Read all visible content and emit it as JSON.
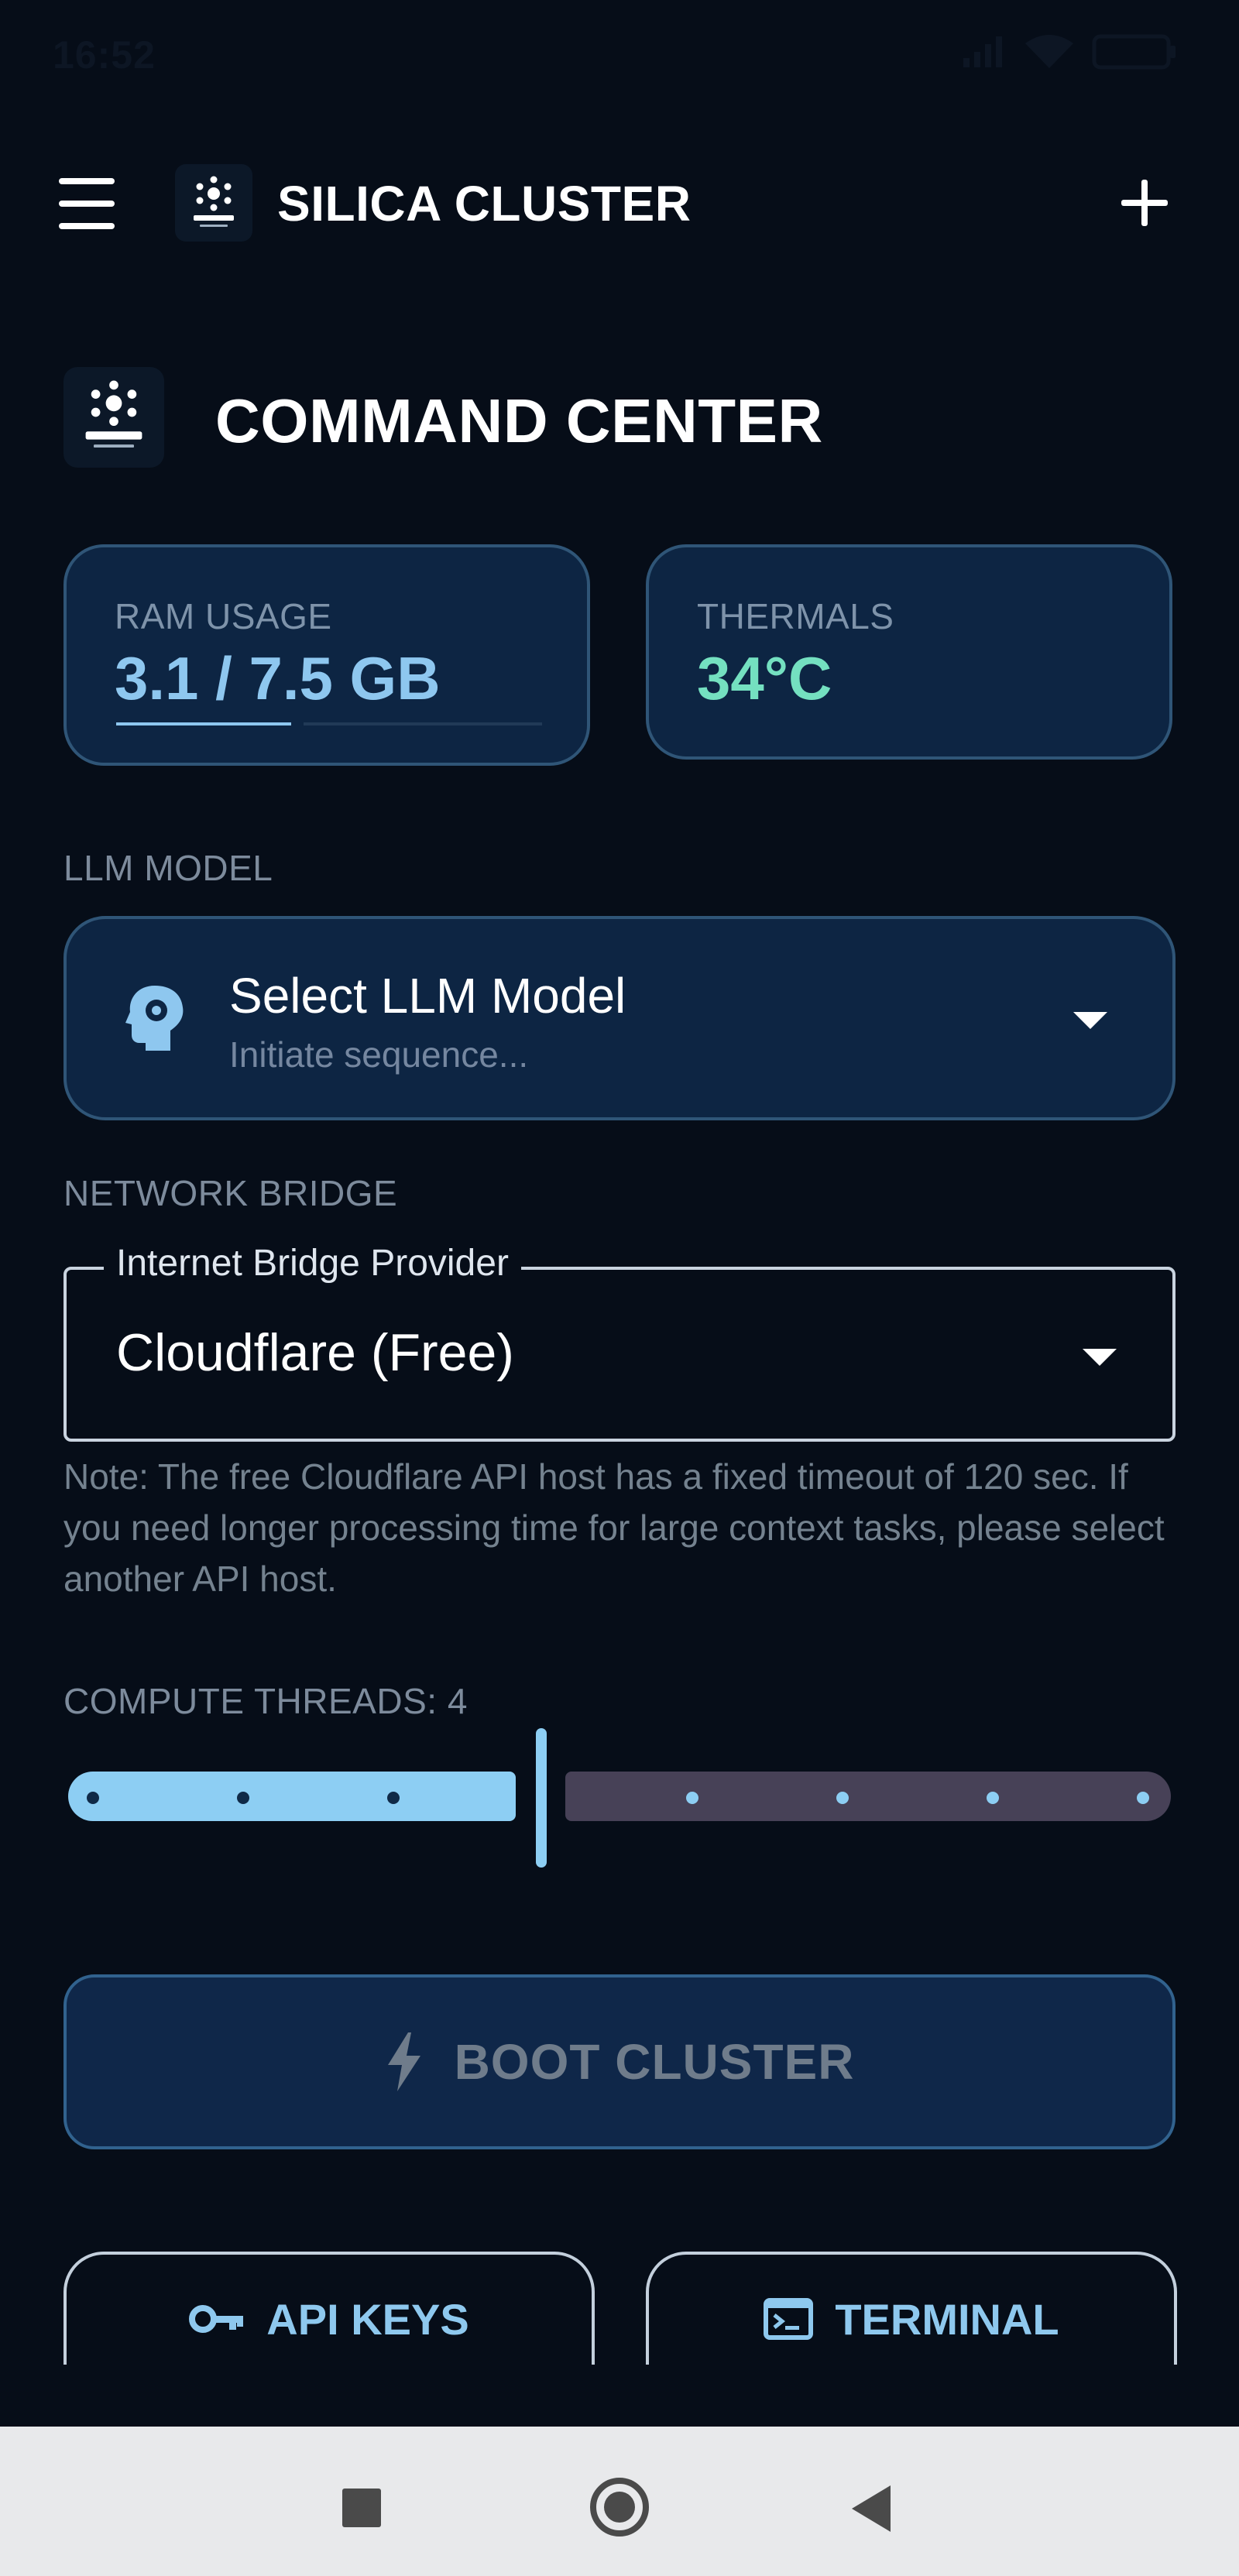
{
  "status_bar": {
    "time": "16:52"
  },
  "app_bar": {
    "title": "SILICA CLUSTER"
  },
  "section": {
    "title": "COMMAND CENTER"
  },
  "stats": {
    "ram": {
      "label": "RAM USAGE",
      "value": "3.1 / 7.5 GB",
      "fraction": 0.41,
      "color": "#8ec7ef"
    },
    "thermals": {
      "label": "THERMALS",
      "value": "34°C",
      "color": "#74e0c0"
    }
  },
  "llm": {
    "section_label": "LLM MODEL",
    "title": "Select LLM Model",
    "subtitle": "Initiate sequence..."
  },
  "network": {
    "section_label": "NETWORK BRIDGE",
    "field_label": "Internet Bridge Provider",
    "value": "Cloudflare (Free)",
    "note": "Note: The free Cloudflare API host has a fixed timeout of 120 sec. If you need longer processing time for large context tasks, please select another API host."
  },
  "threads": {
    "label": "COMPUTE THREADS: 4",
    "value": 4,
    "min": 1,
    "max": 8
  },
  "actions": {
    "boot_label": "BOOT CLUSTER",
    "api_keys_label": "API KEYS",
    "terminal_label": "TERMINAL"
  },
  "icons": {
    "menu": "menu-icon",
    "add": "add-icon",
    "llm": "psychology-icon",
    "dropdown": "arrow-drop-down-icon",
    "boot": "bolt-icon",
    "api_keys": "key-icon",
    "terminal": "terminal-icon",
    "nav_recents": "square-icon",
    "nav_home": "home-circle-icon",
    "nav_back": "back-triangle-icon"
  }
}
